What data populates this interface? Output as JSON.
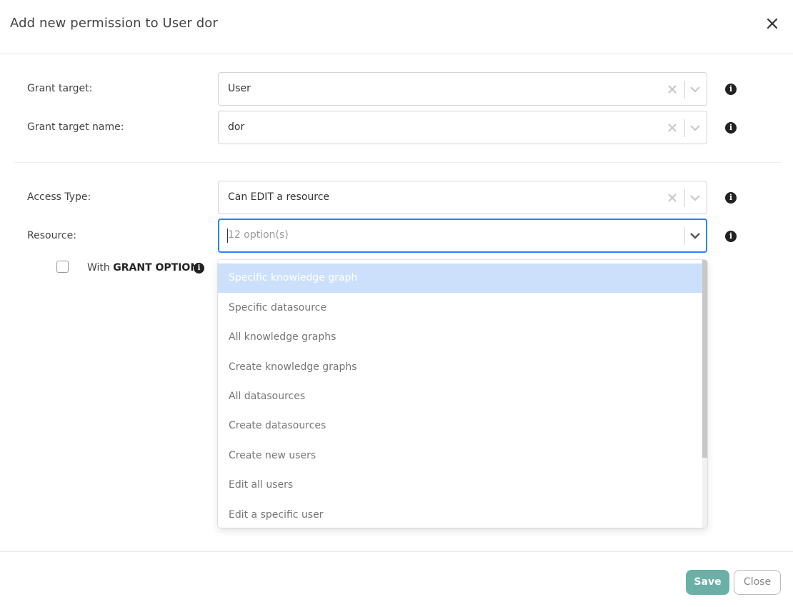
{
  "dialog": {
    "title": "Add new permission to User dor",
    "close_icon": "close-icon"
  },
  "form": {
    "grant_target": {
      "label": "Grant target:",
      "value": "User"
    },
    "grant_target_name": {
      "label": "Grant target name:",
      "value": "dor"
    },
    "access_type": {
      "label": "Access Type:",
      "value": "Can EDIT a resource"
    },
    "resource": {
      "label": "Resource:",
      "placeholder": "12 option(s)"
    },
    "grant_option": {
      "prefix": "With ",
      "bold": "GRANT OPTION",
      "checked": false
    },
    "info_glyph": "i"
  },
  "resource_menu": {
    "options": [
      "Specific knowledge graph",
      "Specific datasource",
      "All knowledge graphs",
      "Create knowledge graphs",
      "All datasources",
      "Create datasources",
      "Create new users",
      "Edit all users",
      "Edit a specific user"
    ],
    "highlighted_index": 0
  },
  "footer": {
    "save_label": "Save",
    "close_label": "Close"
  },
  "colors": {
    "focus": "#2684ff",
    "highlight": "#cce0fb",
    "save": "#6ab0a6"
  }
}
